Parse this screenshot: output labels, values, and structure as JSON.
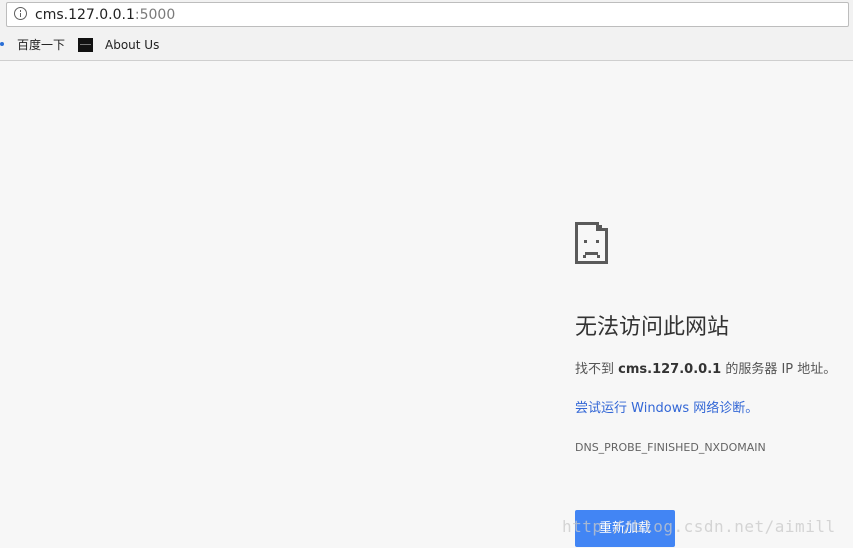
{
  "address_bar": {
    "host": "cms.127.0.0.1",
    "port": ":5000"
  },
  "bookmarks": [
    {
      "label": "百度一下",
      "icon": "paw-icon"
    },
    {
      "label": "About Us",
      "icon": "bookmark-favicon"
    }
  ],
  "error": {
    "icon": "sad-page-icon",
    "heading": "无法访问此网站",
    "detail_prefix": "找不到",
    "detail_host": "cms.127.0.0.1",
    "detail_suffix": "的服务器 IP 地址。",
    "suggestion": "尝试运行 Windows 网络诊断。",
    "code": "DNS_PROBE_FINISHED_NXDOMAIN",
    "reload_label": "重新加载"
  },
  "watermark": "http://blog.csdn.net/aimill",
  "colors": {
    "link": "#3367d6",
    "button": "#4285f4",
    "background": "#f7f7f7"
  }
}
